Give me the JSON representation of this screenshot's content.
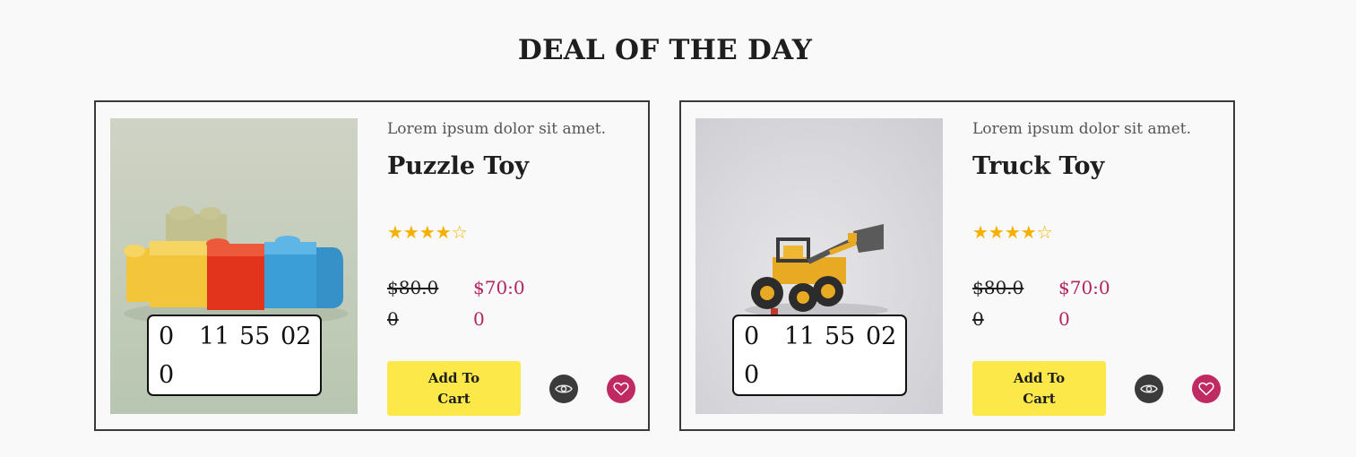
{
  "section": {
    "title": "DEAL OF THE DAY"
  },
  "colors": {
    "accent": "#fde84a",
    "price": "#b3255f",
    "star": "#f5b000",
    "wish": "#c02a62",
    "view": "#3b3b3b"
  },
  "products": [
    {
      "image": "puzzle-toy-photo",
      "tagline": "Lorem ipsum dolor sit amet.",
      "name": "Puzzle Toy",
      "rating": 4,
      "stars": "★★★★☆",
      "old_price": "$80.00",
      "new_price": "$70:00",
      "timer": {
        "days": "0",
        "hours": "11",
        "minutes": "55",
        "seconds": "02",
        "extra": "0"
      },
      "cart_label": "Add To Cart",
      "view_icon": "eye-icon",
      "wish_icon": "heart-icon"
    },
    {
      "image": "truck-toy-photo",
      "tagline": "Lorem ipsum dolor sit amet.",
      "name": "Truck Toy",
      "rating": 4,
      "stars": "★★★★☆",
      "old_price": "$80.00",
      "new_price": "$70:00",
      "timer": {
        "days": "0",
        "hours": "11",
        "minutes": "55",
        "seconds": "02",
        "extra": "0"
      },
      "cart_label": "Add To Cart",
      "view_icon": "eye-icon",
      "wish_icon": "heart-icon"
    }
  ]
}
